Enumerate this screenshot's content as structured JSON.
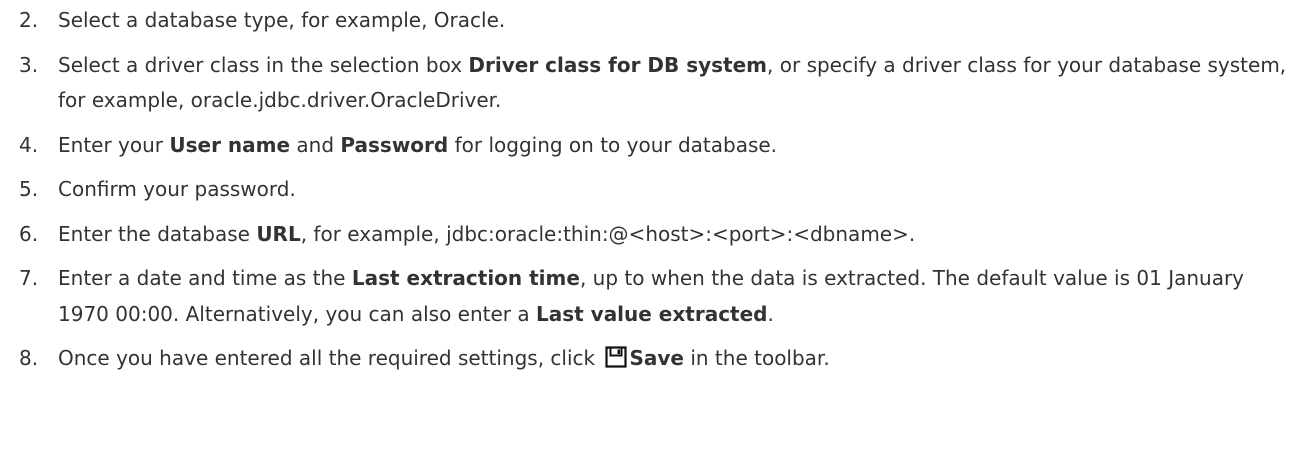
{
  "steps": [
    {
      "number": "2.",
      "parts": [
        {
          "text": "Select a database type, for example, Oracle."
        }
      ]
    },
    {
      "number": "3.",
      "parts": [
        {
          "text": "Select a driver class in the selection box "
        },
        {
          "text": "Driver class for DB system",
          "bold": true
        },
        {
          "text": ", or specify a driver class for your database system, for example, oracle.jdbc.driver.OracleDriver."
        }
      ]
    },
    {
      "number": "4.",
      "parts": [
        {
          "text": "Enter your "
        },
        {
          "text": "User name",
          "bold": true
        },
        {
          "text": " and "
        },
        {
          "text": "Password",
          "bold": true
        },
        {
          "text": " for logging on to your database."
        }
      ]
    },
    {
      "number": "5.",
      "parts": [
        {
          "text": "Confirm your password."
        }
      ]
    },
    {
      "number": "6.",
      "parts": [
        {
          "text": "Enter the database "
        },
        {
          "text": "URL",
          "bold": true
        },
        {
          "text": ", for example, jdbc:oracle:thin:@<host>:<port>:<dbname>."
        }
      ]
    },
    {
      "number": "7.",
      "parts": [
        {
          "text": "Enter a date and time as the "
        },
        {
          "text": "Last extraction time",
          "bold": true
        },
        {
          "text": ", up to when the data is extracted. The default value is 01 January 1970 00:00. Alternatively, you can also enter a "
        },
        {
          "text": "Last value extracted",
          "bold": true
        },
        {
          "text": "."
        }
      ]
    },
    {
      "number": "8.",
      "parts": [
        {
          "text": "Once you have entered all the required settings, click "
        },
        {
          "icon": "save-icon"
        },
        {
          "text": "Save",
          "bold": true
        },
        {
          "text": " in the toolbar."
        }
      ]
    }
  ]
}
